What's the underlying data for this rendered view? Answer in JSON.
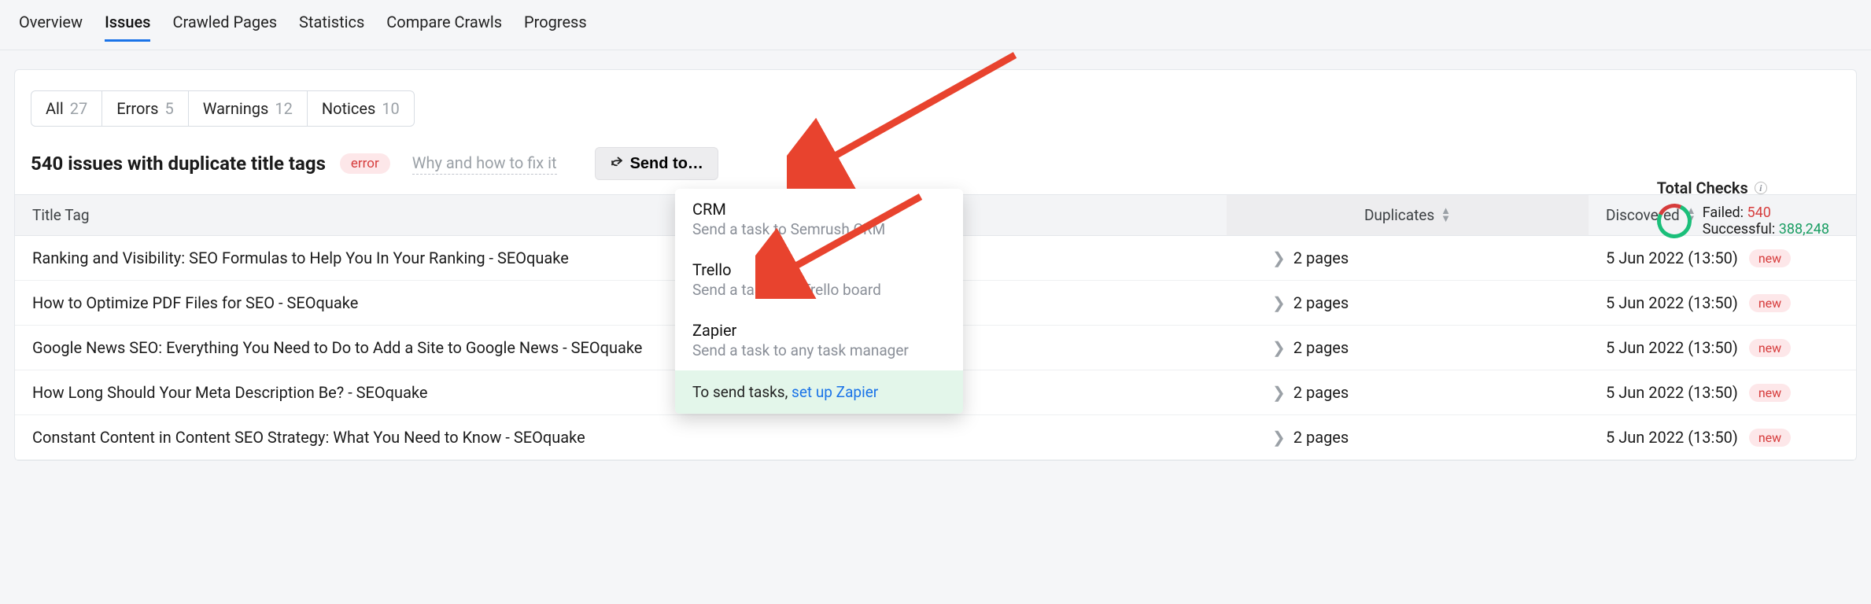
{
  "tabs": [
    "Overview",
    "Issues",
    "Crawled Pages",
    "Statistics",
    "Compare Crawls",
    "Progress"
  ],
  "active_tab_index": 1,
  "filters": [
    {
      "label": "All",
      "count": "27"
    },
    {
      "label": "Errors",
      "count": "5"
    },
    {
      "label": "Warnings",
      "count": "12"
    },
    {
      "label": "Notices",
      "count": "10"
    }
  ],
  "heading": "540 issues with duplicate title tags",
  "heading_badge": "error",
  "howfix": "Why and how to fix it",
  "sendto_label": "Send to…",
  "dropdown": [
    {
      "title": "CRM",
      "sub": "Send a task to Semrush CRM"
    },
    {
      "title": "Trello",
      "sub": "Send a task to a Trello board"
    },
    {
      "title": "Zapier",
      "sub": "Send a task to any task manager"
    }
  ],
  "dropdown_footer_prefix": "To send tasks, ",
  "dropdown_footer_link": "set up Zapier",
  "totals": {
    "title": "Total Checks",
    "failed_label": "Failed: ",
    "failed_value": "540",
    "successful_label": "Successful: ",
    "successful_value": "388,248"
  },
  "columns": {
    "title": "Title Tag",
    "duplicates": "Duplicates",
    "discovered": "Discovered"
  },
  "rows": [
    {
      "title": "Ranking and Visibility: SEO Formulas to Help You In Your Ranking - SEOquake",
      "dup": "2 pages",
      "disc": "5 Jun 2022 (13:50)",
      "new": "new"
    },
    {
      "title": "How to Optimize PDF Files for SEO - SEOquake",
      "dup": "2 pages",
      "disc": "5 Jun 2022 (13:50)",
      "new": "new"
    },
    {
      "title": "Google News SEO: Everything You Need to Do to Add a Site to Google News - SEOquake",
      "dup": "2 pages",
      "disc": "5 Jun 2022 (13:50)",
      "new": "new"
    },
    {
      "title": "How Long Should Your Meta Description Be? - SEOquake",
      "dup": "2 pages",
      "disc": "5 Jun 2022 (13:50)",
      "new": "new"
    },
    {
      "title": "Constant Content in Content SEO Strategy: What You Need to Know - SEOquake",
      "dup": "2 pages",
      "disc": "5 Jun 2022 (13:50)",
      "new": "new"
    }
  ]
}
